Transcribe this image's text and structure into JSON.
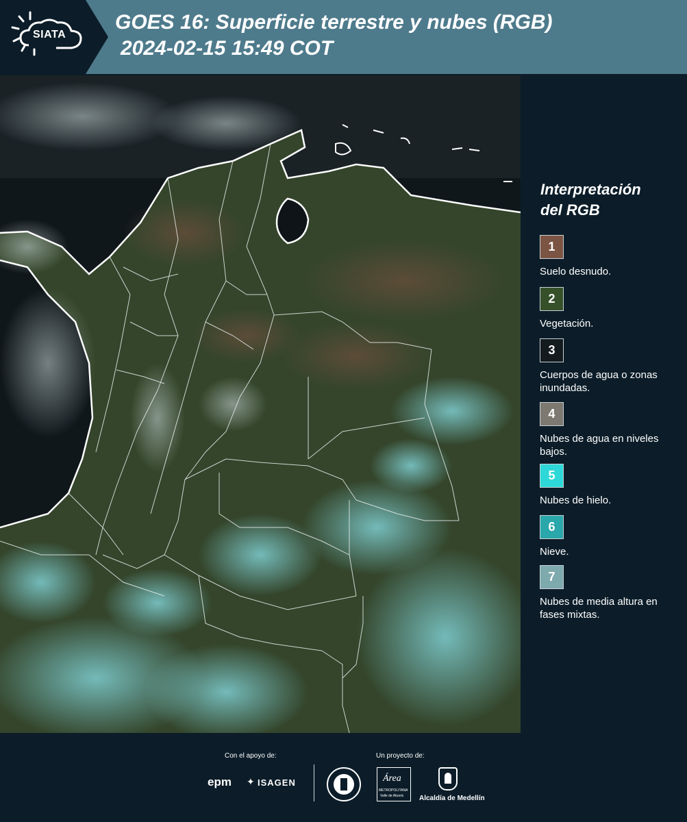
{
  "header": {
    "logo_text": "SIATA",
    "title_line1": "GOES 16: Superficie terrestre y nubes (RGB)",
    "title_line2": "2024-02-15 15:49 COT"
  },
  "legend": {
    "title_line1": "Interpretación",
    "title_line2": "del RGB",
    "items": [
      {
        "number": "1",
        "label": "Suelo desnudo.",
        "color": "#7c5443"
      },
      {
        "number": "2",
        "label": "Vegetación.",
        "color": "#36502a"
      },
      {
        "number": "3",
        "label": "Cuerpos de agua o zonas inundadas.",
        "color": "#141b1f"
      },
      {
        "number": "4",
        "label": "Nubes de agua en niveles bajos.",
        "color": "#7d7870"
      },
      {
        "number": "5",
        "label": "Nubes de hielo.",
        "color": "#2ed8d8"
      },
      {
        "number": "6",
        "label": "Nieve.",
        "color": "#2aa7aa"
      },
      {
        "number": "7",
        "label": "Nubes de media altura en fases mixtas.",
        "color": "#7eaaad"
      }
    ]
  },
  "footer": {
    "support_caption": "Con el apoyo de:",
    "project_caption": "Un proyecto de:",
    "epm": "epm",
    "isagen": "ISAGEN",
    "area_text": "Área",
    "area_sub1": "METROPOLITANA",
    "area_sub2": "Valle de Aburrá",
    "alcaldia": "Alcaldía de Medellín"
  },
  "colors": {
    "header_bg": "#4e7b8c",
    "page_bg": "#0c1d29",
    "land": "#34452b",
    "ocean": "#0e1418",
    "cloud_cyan": "#5fb3b8"
  }
}
